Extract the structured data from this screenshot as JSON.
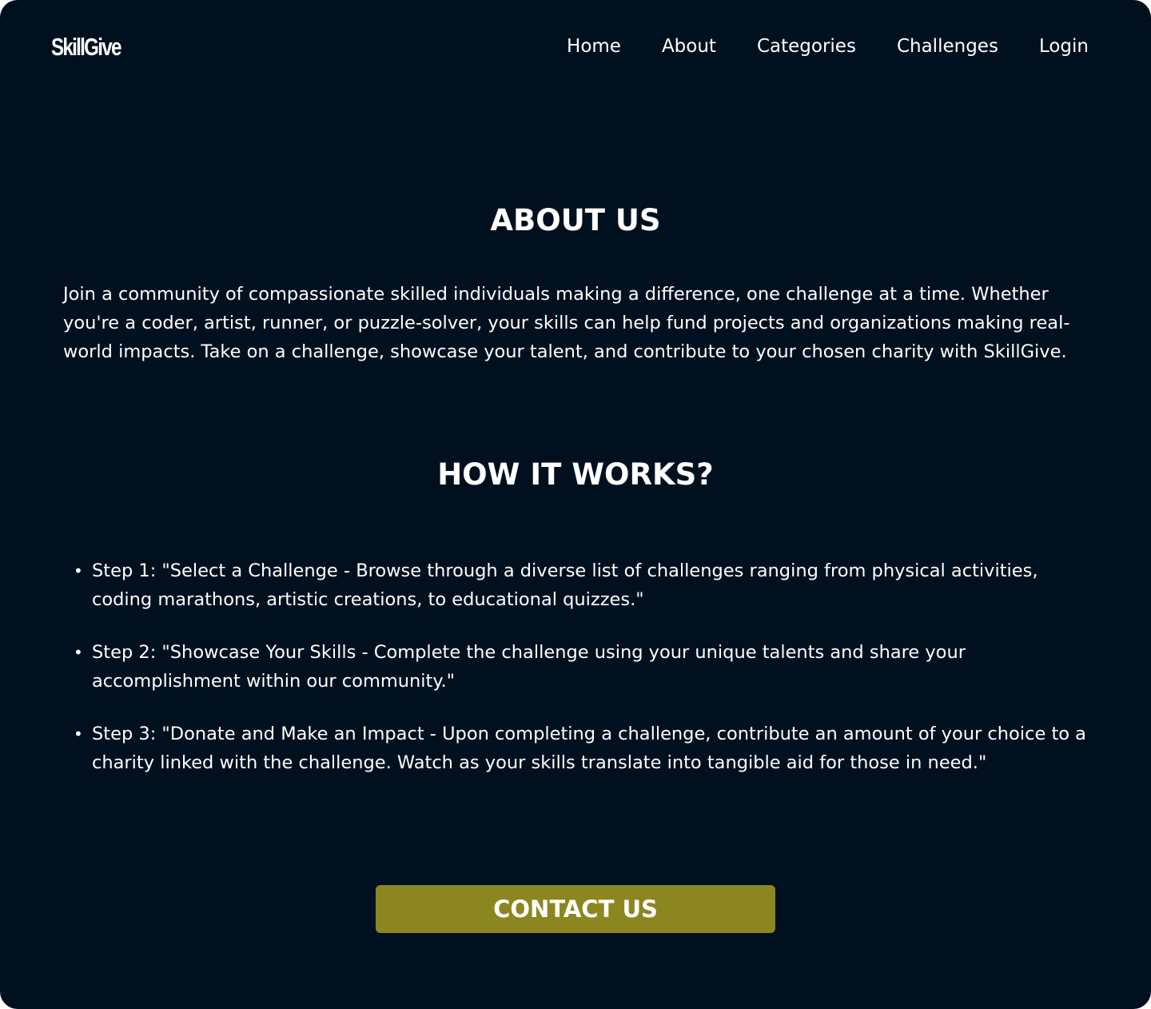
{
  "brand": {
    "logo_text": "SkillGive"
  },
  "nav": {
    "items": [
      {
        "label": "Home"
      },
      {
        "label": "About"
      },
      {
        "label": "Categories"
      },
      {
        "label": "Challenges"
      },
      {
        "label": "Login"
      }
    ]
  },
  "about": {
    "title": "ABOUT US",
    "body": "Join a community of compassionate skilled individuals making a difference, one challenge at a time. Whether you're a coder, artist, runner, or puzzle-solver, your skills can help fund projects and organizations making real-world impacts. Take on a challenge, showcase your talent, and contribute to your chosen charity with SkillGive."
  },
  "how_it_works": {
    "title": "HOW IT WORKS?",
    "steps": [
      {
        "text": "Step 1: \"Select a Challenge - Browse through a diverse list of challenges ranging from physical activities, coding marathons, artistic creations, to educational quizzes.\""
      },
      {
        "text": "Step 2: \"Showcase Your Skills - Complete the challenge using your unique talents and share your accomplishment within our community.\""
      },
      {
        "text": "Step 3: \"Donate and Make an Impact - Upon completing a challenge, contribute an amount of your choice to a charity linked with the challenge. Watch as your skills translate into tangible aid for those in need.\""
      }
    ]
  },
  "contact": {
    "button_label": "CONTACT US"
  },
  "colors": {
    "background": "#00101f",
    "text": "#ffffff",
    "button": "#8c8620"
  }
}
